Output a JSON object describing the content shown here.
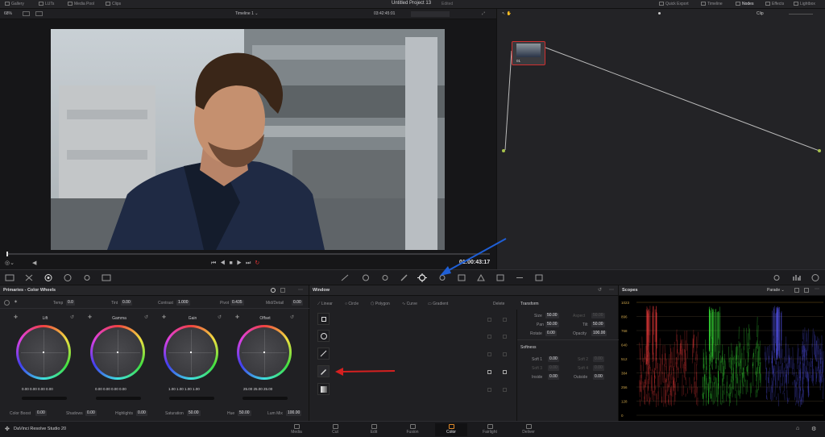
{
  "topbar": {
    "gallery": "Gallery",
    "luts": "LUTs",
    "media_pool": "Media Pool",
    "clips": "Clips",
    "project_title": "Untitled Project 13",
    "project_state": "Edited",
    "quick_export": "Quick Export",
    "timeline": "Timeline",
    "nodes": "Nodes",
    "effects": "Effects",
    "lightbox": "Lightbox"
  },
  "viewerbar": {
    "zoom": "68%",
    "timeline_name": "Timeline 1",
    "timecode": "03:42:45:01",
    "clip_mode": "Clip"
  },
  "viewer": {
    "playhead_timecode": "01:00:43:17"
  },
  "node": {
    "label": "01"
  },
  "primaries": {
    "title": "Primaries - Color Wheels",
    "temp_label": "Temp",
    "temp": "0.0",
    "tint_label": "Tint",
    "tint": "0.00",
    "contrast_label": "Contrast",
    "contrast": "1.000",
    "pivot_label": "Pivot",
    "pivot": "0.435",
    "middetail_label": "Mid/Detail",
    "middetail": "0.00",
    "wheels": [
      {
        "name": "Lift",
        "values": "0.00  0.00  0.00  0.00"
      },
      {
        "name": "Gamma",
        "values": "0.00  0.00  0.00  0.00"
      },
      {
        "name": "Gain",
        "values": "1.00  1.00  1.00  1.00"
      },
      {
        "name": "Offset",
        "values": "25.00  25.00  25.00"
      }
    ],
    "colorboost_label": "Color Boost",
    "colorboost": "0.00",
    "shadows_label": "Shadows",
    "shadows": "0.00",
    "highlights_label": "Highlights",
    "highlights": "0.00",
    "saturation_label": "Saturation",
    "saturation": "50.00",
    "hue_label": "Hue",
    "hue": "50.00",
    "lummix_label": "Lum Mix",
    "lummix": "100.00"
  },
  "window": {
    "title": "Window",
    "linear": "Linear",
    "circle": "Circle",
    "polygon": "Polygon",
    "curve": "Curve",
    "gradient": "Gradient",
    "delete": "Delete",
    "transform_title": "Transform",
    "size_label": "Size",
    "size": "50.00",
    "aspect_label": "Aspect",
    "aspect": "50.00",
    "pan_label": "Pan",
    "pan": "50.00",
    "tilt_label": "Tilt",
    "tilt": "50.00",
    "rotate_label": "Rotate",
    "rotate": "0.00",
    "opacity_label": "Opacity",
    "opacity": "100.00",
    "softness_title": "Softness",
    "soft1_label": "Soft 1",
    "soft1": "0.00",
    "soft2_label": "Soft 2",
    "soft2": "0.00",
    "soft3_label": "Soft 3",
    "soft3": "0.00",
    "soft4_label": "Soft 4",
    "soft4": "0.00",
    "inside_label": "Inside",
    "inside": "0.00",
    "outside_label": "Outside",
    "outside": "0.00"
  },
  "scopes": {
    "title": "Scopes",
    "mode": "Parade",
    "ticks": [
      "1023",
      "896",
      "768",
      "640",
      "512",
      "384",
      "256",
      "128",
      "0"
    ]
  },
  "pages": {
    "app_name": "DaVinci Resolve Studio 20",
    "tabs": [
      "Media",
      "Cut",
      "Edit",
      "Fusion",
      "Color",
      "Fairlight",
      "Deliver"
    ],
    "active": "Color"
  },
  "colors": {
    "accent": "#e08a2a",
    "annotation_blue": "#1f5fd6",
    "annotation_red": "#d62020"
  }
}
